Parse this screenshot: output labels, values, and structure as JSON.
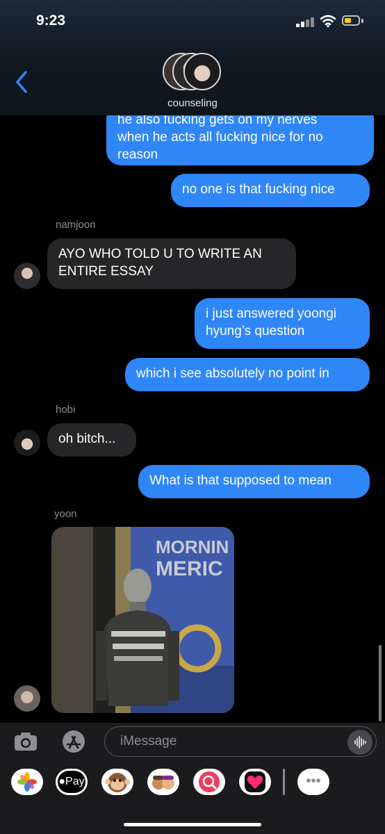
{
  "status_bar": {
    "time": "9:23"
  },
  "conversation": {
    "name": "counseling"
  },
  "messages": {
    "cut_off_line": "he also fucking gets on my nerves",
    "m1": "when he acts all fucking nice for no reason",
    "m2": "no one is that fucking nice",
    "namjoon_sender": "namjoon",
    "m3": "AYO WHO TOLD U TO WRITE AN ENTIRE ESSAY",
    "m4": "i just answered yoongi hyung’s question",
    "m5": "which i see absolutely no point in",
    "hobi_sender": "hobi",
    "m6": "oh bitch...",
    "m7": "What is that supposed to mean",
    "yoon_sender": "yoon",
    "photo_text": "MORNIN\nMERIC"
  },
  "input": {
    "placeholder": "iMessage"
  },
  "tray": {
    "apple_pay": "Pay",
    "more": "•••"
  },
  "colors": {
    "blue_bubble": "#2f86f7",
    "gray_bubble": "#262628",
    "background": "#000000"
  },
  "icons": [
    "back-chevron-icon",
    "camera-icon",
    "app-store-icon",
    "dictation-icon",
    "photos-icon",
    "apple-pay-icon",
    "monkey-memoji-icon",
    "memoji-icon",
    "search-images-icon",
    "digital-touch-icon",
    "more-icon"
  ]
}
